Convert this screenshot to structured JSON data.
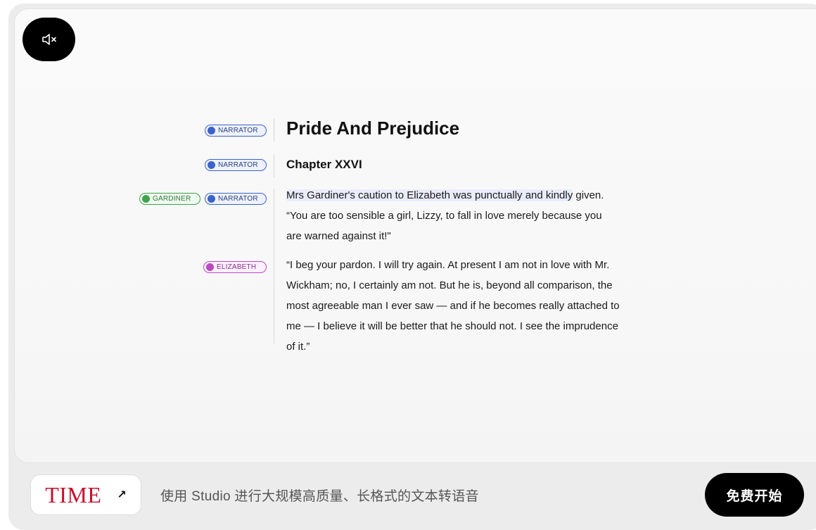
{
  "mute_button": {
    "icon": "speaker-muted-icon"
  },
  "document": {
    "title": "Pride And Prejudice",
    "chapter": "Chapter XXVI",
    "paragraphs": [
      {
        "highlighted": "Mrs Gardiner's caution to Elizabeth was punctually and kindly",
        "rest": " given.",
        "line2": "“You are too sensible a girl, Lizzy, to fall in love merely because you",
        "line3": "are warned against it!\""
      },
      {
        "line1": "“I beg your pardon. I will try again. At present I am not in love with Mr.",
        "line2": "Wickham; no, I certainly am not. But he is, beyond all comparison, the",
        "line3": "most agreeable man I ever saw — and if he becomes really attached to",
        "line4": "me — I believe it will be better that he should not. I see the imprudence",
        "line5": "of it.”"
      }
    ]
  },
  "speakers": {
    "narrator": "NARRATOR",
    "gardiner": "GARDINER",
    "elizabeth": "ELIZABETH"
  },
  "colors": {
    "narrator": "#3b63c9",
    "gardiner": "#3fa34d",
    "elizabeth": "#b94ac2",
    "time_brand": "#c8102e"
  },
  "footer": {
    "brand_logo": "TIME",
    "brand_arrow": "↗",
    "tagline": "使用 Studio 进行大规模高质量、长格式的文本转语音",
    "cta_label": "免费开始"
  }
}
